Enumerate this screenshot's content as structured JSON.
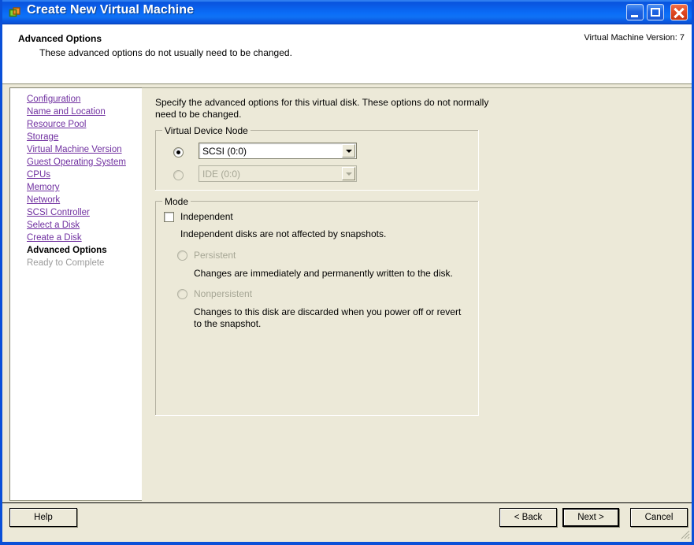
{
  "window": {
    "title": "Create New Virtual Machine",
    "icon": "vmware-window-icon",
    "controls": {
      "minimize": "Minimize",
      "maximize": "Maximize",
      "close": "Close"
    }
  },
  "header": {
    "title": "Advanced Options",
    "subtitle": "These advanced options do not usually need to be changed.",
    "version_label": "Virtual Machine Version: 7"
  },
  "sidebar": {
    "items": [
      {
        "label": "Configuration",
        "state": "link"
      },
      {
        "label": "Name and Location",
        "state": "link"
      },
      {
        "label": "Resource Pool",
        "state": "link"
      },
      {
        "label": "Storage",
        "state": "link"
      },
      {
        "label": "Virtual Machine Version",
        "state": "link"
      },
      {
        "label": "Guest Operating System",
        "state": "link"
      },
      {
        "label": "CPUs",
        "state": "link"
      },
      {
        "label": "Memory",
        "state": "link"
      },
      {
        "label": "Network",
        "state": "link"
      },
      {
        "label": "SCSI Controller",
        "state": "link"
      },
      {
        "label": "Select a Disk",
        "state": "link"
      },
      {
        "label": "Create a Disk",
        "state": "link"
      },
      {
        "label": "Advanced Options",
        "state": "current"
      },
      {
        "label": "Ready to Complete",
        "state": "disabled"
      }
    ]
  },
  "main": {
    "intro": "Specify the advanced options for this virtual disk. These options do not normally need to be changed.",
    "virtual_device_node": {
      "group_title": "Virtual Device Node",
      "scsi": {
        "selected": true,
        "value": "SCSI (0:0)",
        "enabled": true
      },
      "ide": {
        "selected": false,
        "value": "IDE (0:0)",
        "enabled": false
      }
    },
    "mode": {
      "group_title": "Mode",
      "independent": {
        "label": "Independent",
        "checked": false,
        "description": "Independent disks are not affected by snapshots."
      },
      "persistent": {
        "label": "Persistent",
        "selected": false,
        "enabled": false,
        "description": "Changes are immediately and permanently written to the disk."
      },
      "nonpersistent": {
        "label": "Nonpersistent",
        "selected": false,
        "enabled": false,
        "description": "Changes to this disk are discarded when you power off or revert to the snapshot."
      }
    }
  },
  "footer": {
    "help": "Help",
    "back": "< Back",
    "next": "Next >",
    "cancel": "Cancel"
  },
  "colors": {
    "title_blue": "#0a59e2",
    "face": "#ece9d8",
    "link_purple": "#7030a0",
    "close_red": "#e24a24"
  }
}
